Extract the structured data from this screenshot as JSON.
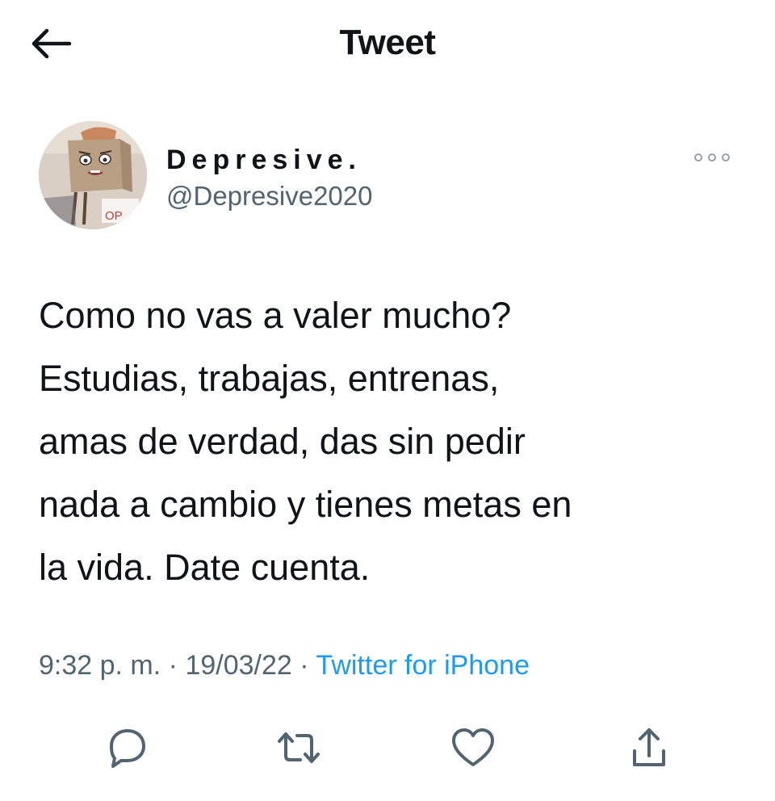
{
  "header": {
    "title": "Tweet",
    "back_icon": "arrow-left-icon"
  },
  "author": {
    "display_name": "Depresive.",
    "handle": "@Depresive2020",
    "avatar_badge": "OP"
  },
  "tweet": {
    "lines": [
      "Como no vas a valer mucho?",
      "Estudias, trabajas, entrenas,",
      "amas de verdad, das sin pedir",
      "nada a cambio y tienes metas en",
      "la vida. Date cuenta."
    ]
  },
  "meta": {
    "time": "9:32 p. m.",
    "date": "19/03/22",
    "separator": "·",
    "source": "Twitter for iPhone"
  },
  "actions": [
    {
      "icon": "reply-icon"
    },
    {
      "icon": "retweet-icon"
    },
    {
      "icon": "like-icon"
    },
    {
      "icon": "share-icon"
    }
  ],
  "colors": {
    "text": "#0f1419",
    "secondary": "#536471",
    "link": "#1d9bf0"
  }
}
